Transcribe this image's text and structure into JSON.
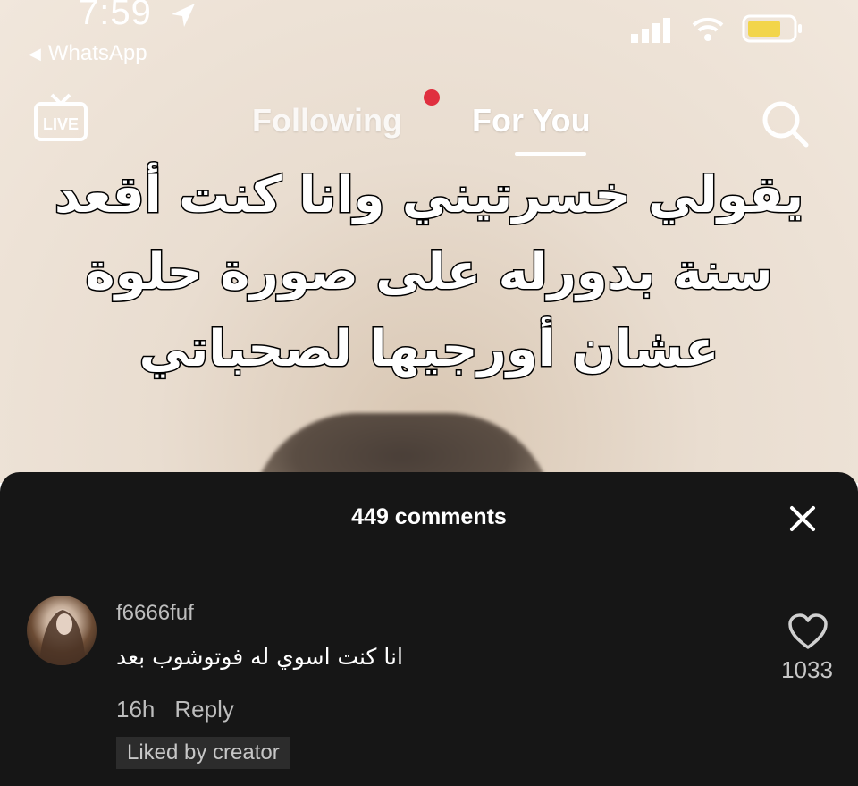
{
  "status_bar": {
    "time": "7:59",
    "back_app": "WhatsApp",
    "battery_color": "#f2d54a"
  },
  "top_nav": {
    "live_label": "LIVE",
    "tabs": [
      {
        "label": "Following",
        "active": false
      },
      {
        "label": "For You",
        "active": true
      }
    ],
    "notification_dot_color": "#e02f3f"
  },
  "video": {
    "caption_lines": [
      "يقولي خسرتيني وانا كنت أقعد",
      "سنة بدورله على صورة حلوة",
      "عشان أورجيها لصحباتي"
    ]
  },
  "comments_sheet": {
    "count_label": "449 comments",
    "comments": [
      {
        "username": "f6666fuf",
        "text": "انا كنت اسوي له فوتوشوب بعد",
        "time": "16h",
        "reply_label": "Reply",
        "badge": "Liked by creator",
        "likes": "1033"
      }
    ]
  },
  "icons": {
    "live": "live-tv-icon",
    "search": "search-icon",
    "close": "close-icon",
    "heart": "heart-icon",
    "location": "location-arrow-icon"
  }
}
